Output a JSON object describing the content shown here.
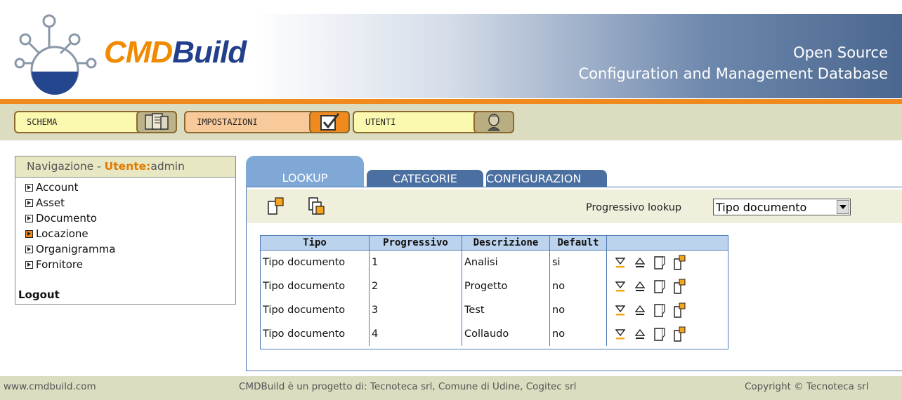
{
  "header": {
    "logo_cmd": "CMD",
    "logo_build": "Build",
    "tagline_line1": "Open Source",
    "tagline_line2": "Configuration and Management Database",
    "brand_orange": "#f08a1e",
    "brand_blue": "#223f8c"
  },
  "menu": {
    "items": [
      {
        "label": "SCHEMA",
        "icon": "schema-icon"
      },
      {
        "label": "IMPOSTAZIONI",
        "icon": "settings-checklist-icon",
        "active": true
      },
      {
        "label": "UTENTI",
        "icon": "user-icon"
      }
    ]
  },
  "sidebar": {
    "title_prefix": "Navigazione - ",
    "user_label": "Utente:",
    "username": "admin",
    "items": [
      {
        "label": "Account"
      },
      {
        "label": "Asset"
      },
      {
        "label": "Documento"
      },
      {
        "label": "Locazione",
        "selected": true
      },
      {
        "label": "Organigramma"
      },
      {
        "label": "Fornitore"
      }
    ],
    "logout": "Logout"
  },
  "tabs": [
    {
      "label": "LOOKUP",
      "active": true
    },
    {
      "label": "CATEGORIE"
    },
    {
      "label": "CONFIGURAZION"
    }
  ],
  "toolbar": {
    "lookup_label": "Progressivo lookup",
    "lookup_selected": "Tipo documento"
  },
  "table": {
    "headers": [
      "Tipo",
      "Progressivo",
      "Descrizione",
      "Default"
    ],
    "rows": [
      {
        "tipo": "Tipo documento",
        "progressivo": "1",
        "descrizione": "Analisi",
        "default": "si"
      },
      {
        "tipo": "Tipo documento",
        "progressivo": "2",
        "descrizione": "Progetto",
        "default": "no"
      },
      {
        "tipo": "Tipo documento",
        "progressivo": "3",
        "descrizione": "Test",
        "default": "no"
      },
      {
        "tipo": "Tipo documento",
        "progressivo": "4",
        "descrizione": "Collaudo",
        "default": "no"
      }
    ],
    "row_actions": [
      "move-down-icon",
      "move-up-icon",
      "edit-document-icon",
      "new-document-icon"
    ]
  },
  "footer": {
    "site": "www.cmdbuild.com",
    "credits": "CMDBuild è un progetto di: Tecnoteca srl, Comune di Udine, Cogitec srl",
    "copyright": "Copyright © Tecnoteca srl"
  }
}
